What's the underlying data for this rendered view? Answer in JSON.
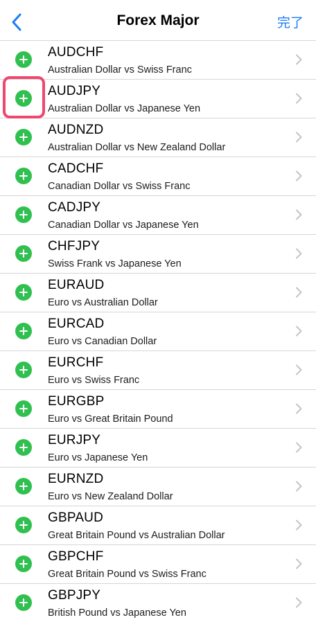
{
  "navbar": {
    "title": "Forex Major",
    "done_label": "完了",
    "back_icon": "chevron-left-icon",
    "accent_color": "#1a7cf5"
  },
  "colors": {
    "add_button": "#30c04f",
    "highlight": "#f0476f"
  },
  "symbols": [
    {
      "symbol": "AUDCHF",
      "description": "Australian Dollar vs Swiss Franc"
    },
    {
      "symbol": "AUDJPY",
      "description": "Australian Dollar vs Japanese Yen"
    },
    {
      "symbol": "AUDNZD",
      "description": "Australian Dollar vs New Zealand Dollar"
    },
    {
      "symbol": "CADCHF",
      "description": "Canadian Dollar vs Swiss Franc"
    },
    {
      "symbol": "CADJPY",
      "description": "Canadian Dollar vs Japanese Yen"
    },
    {
      "symbol": "CHFJPY",
      "description": "Swiss Frank vs Japanese Yen"
    },
    {
      "symbol": "EURAUD",
      "description": "Euro vs Australian Dollar"
    },
    {
      "symbol": "EURCAD",
      "description": "Euro vs Canadian Dollar"
    },
    {
      "symbol": "EURCHF",
      "description": "Euro vs Swiss Franc"
    },
    {
      "symbol": "EURGBP",
      "description": "Euro vs Great Britain Pound"
    },
    {
      "symbol": "EURJPY",
      "description": "Euro vs Japanese Yen"
    },
    {
      "symbol": "EURNZD",
      "description": "Euro vs New Zealand Dollar"
    },
    {
      "symbol": "GBPAUD",
      "description": "Great Britain Pound vs Australian Dollar"
    },
    {
      "symbol": "GBPCHF",
      "description": "Great Britain Pound vs Swiss Franc"
    },
    {
      "symbol": "GBPJPY",
      "description": "British Pound vs Japanese Yen"
    }
  ]
}
